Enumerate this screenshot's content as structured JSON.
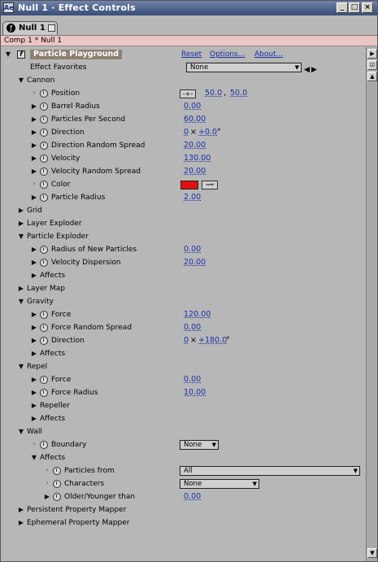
{
  "window": {
    "title": "Null 1 · Effect Controls",
    "tab_label": "Null 1",
    "comp_path": "Comp 1 * Null 1"
  },
  "effect": {
    "name": "Particle Playground",
    "reset": "Reset",
    "options": "Options...",
    "about": "About...",
    "favorites_label": "Effect Favorites",
    "favorites_value": "None"
  },
  "rows": [
    {
      "key": "cannon",
      "label": "Cannon"
    },
    {
      "key": "position",
      "label": "Position",
      "v1": "50.0",
      "sep": ",",
      "v2": "50.0"
    },
    {
      "key": "barrel_radius",
      "label": "Barrel Radius",
      "value": "0.00"
    },
    {
      "key": "particles_per_second",
      "label": "Particles Per Second",
      "value": "60.00"
    },
    {
      "key": "direction",
      "label": "Direction",
      "v1": "0",
      "sep": "×",
      "v2": "+0.0",
      "unit": "°"
    },
    {
      "key": "direction_random_spread",
      "label": "Direction Random Spread",
      "value": "20.00"
    },
    {
      "key": "velocity",
      "label": "Velocity",
      "value": "130.00"
    },
    {
      "key": "velocity_random_spread",
      "label": "Velocity Random Spread",
      "value": "20.00"
    },
    {
      "key": "color",
      "label": "Color",
      "color": "#e01010"
    },
    {
      "key": "particle_radius",
      "label": "Particle Radius",
      "value": "2.00"
    },
    {
      "key": "grid",
      "label": "Grid"
    },
    {
      "key": "layer_exploder",
      "label": "Layer Exploder"
    },
    {
      "key": "particle_exploder",
      "label": "Particle Exploder"
    },
    {
      "key": "radius_new",
      "label": "Radius of New Particles",
      "value": "0.00"
    },
    {
      "key": "velocity_dispersion",
      "label": "Velocity Dispersion",
      "value": "20.00"
    },
    {
      "key": "pe_affects",
      "label": "Affects"
    },
    {
      "key": "layer_map",
      "label": "Layer Map"
    },
    {
      "key": "gravity",
      "label": "Gravity"
    },
    {
      "key": "g_force",
      "label": "Force",
      "value": "120.00"
    },
    {
      "key": "g_force_spread",
      "label": "Force Random Spread",
      "value": "0.00"
    },
    {
      "key": "g_direction",
      "label": "Direction",
      "v1": "0",
      "sep": "×",
      "v2": "+180.0",
      "unit": "°"
    },
    {
      "key": "g_affects",
      "label": "Affects"
    },
    {
      "key": "repel",
      "label": "Repel"
    },
    {
      "key": "r_force",
      "label": "Force",
      "value": "0.00"
    },
    {
      "key": "r_force_radius",
      "label": "Force Radius",
      "value": "10.00"
    },
    {
      "key": "repeller",
      "label": "Repeller"
    },
    {
      "key": "r_affects",
      "label": "Affects"
    },
    {
      "key": "wall",
      "label": "Wall"
    },
    {
      "key": "boundary",
      "label": "Boundary",
      "dropdown": "None"
    },
    {
      "key": "w_affects",
      "label": "Affects"
    },
    {
      "key": "particles_from",
      "label": "Particles from",
      "dropdown": "All"
    },
    {
      "key": "characters",
      "label": "Characters",
      "dropdown": "None"
    },
    {
      "key": "older_younger",
      "label": "Older/Younger than",
      "value": "0.00"
    },
    {
      "key": "ppm",
      "label": "Persistent Property Mapper"
    },
    {
      "key": "epm",
      "label": "Ephemeral Property Mapper"
    }
  ]
}
